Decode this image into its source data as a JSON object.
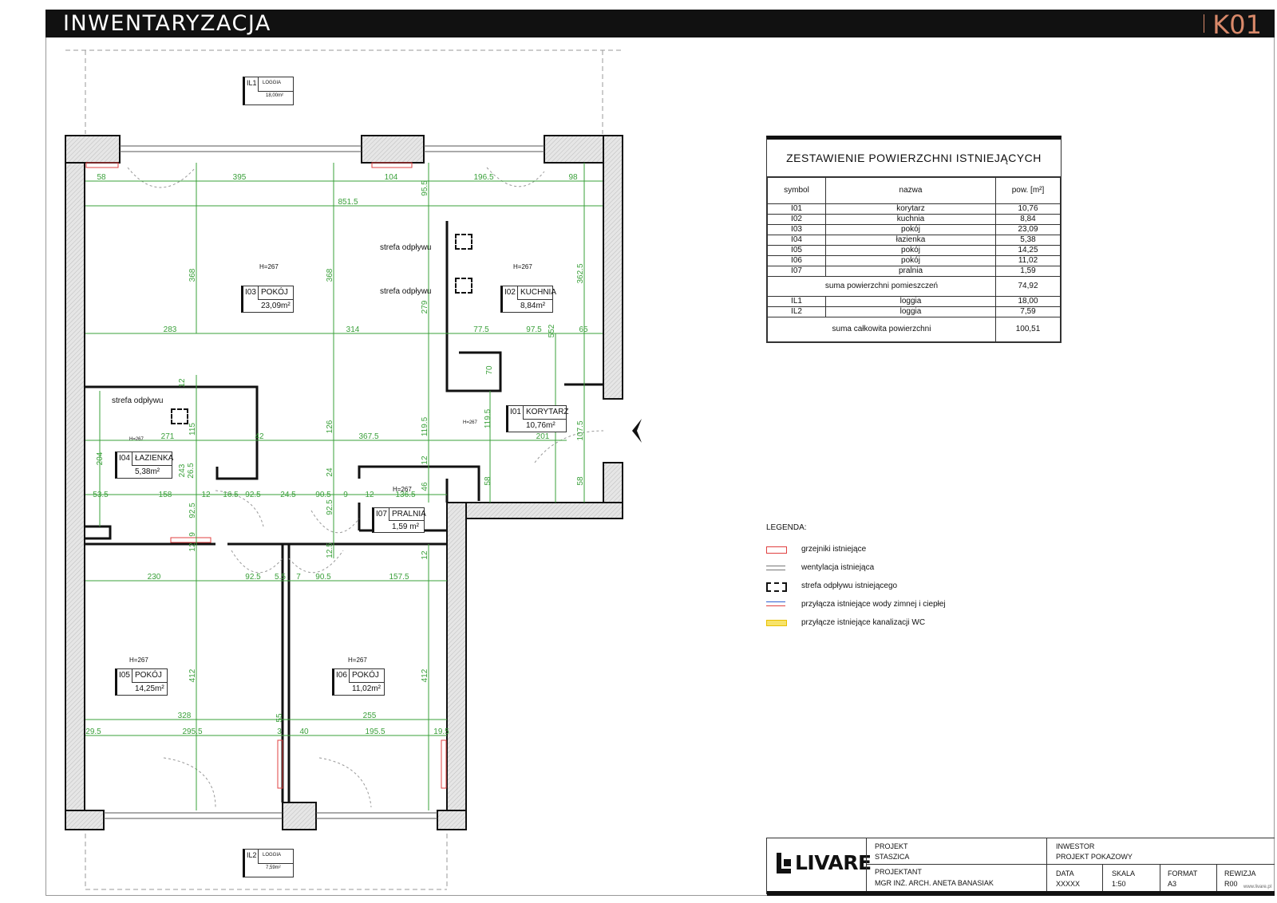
{
  "header": {
    "title": "INWENTARYZACJA",
    "code": "K01"
  },
  "rooms": [
    {
      "id": "IL1",
      "name": "LOGGIA",
      "area": "18,00m²"
    },
    {
      "id": "IL2",
      "name": "LOGGIA",
      "area": "7,59m²"
    },
    {
      "id": "I03",
      "name": "POKÓJ",
      "area": "23,09m²",
      "height": "H=267"
    },
    {
      "id": "I02",
      "name": "KUCHNIA",
      "area": "8,84m²",
      "height": "H=267"
    },
    {
      "id": "I01",
      "name": "KORYTARZ",
      "area": "10,76m²",
      "height": "H=267"
    },
    {
      "id": "I04",
      "name": "ŁAZIENKA",
      "area": "5,38m²",
      "height": "H=267"
    },
    {
      "id": "I07",
      "name": "PRALNIA",
      "area": "1,59 m²",
      "height": "H=267"
    },
    {
      "id": "I05",
      "name": "POKÓJ",
      "area": "14,25m²",
      "height": "H=267"
    },
    {
      "id": "I06",
      "name": "POKÓJ",
      "area": "11,02m²",
      "height": "H=267"
    }
  ],
  "drain_label": "strefa odpływu",
  "dimensions": {
    "top_row": [
      "58",
      "395",
      "104",
      "196.5",
      "98"
    ],
    "overall": "851.5",
    "mid_row": [
      "283",
      "314",
      "77.5",
      "97.5",
      "65"
    ],
    "corridor_row": [
      "271",
      "42",
      "367.5",
      "201"
    ],
    "lower_row": [
      "53.5",
      "158",
      "12",
      "16.5",
      "92.5",
      "24.5",
      "90.5",
      "9",
      "12",
      "136.5"
    ],
    "rooms_row": [
      "230",
      "92.5",
      "5.5",
      "7",
      "90.5",
      "157.5"
    ],
    "bottom_row1": [
      "328",
      "255"
    ],
    "bottom_row2": [
      "29.5",
      "295.5",
      "3",
      "40",
      "195.5",
      "19.5"
    ],
    "vertical": [
      "368",
      "368",
      "95.5",
      "279",
      "362.5",
      "552",
      "70",
      "12",
      "115",
      "126",
      "119.5",
      "119.5",
      "107.5",
      "204",
      "243",
      "26.5",
      "24",
      "12",
      "46",
      "58",
      "58",
      "92.5",
      "92.5",
      "9",
      "12",
      "12.5",
      "12",
      "412",
      "412",
      "55"
    ]
  },
  "area_table": {
    "title": "ZESTAWIENIE POWIERZCHNI ISTNIEJĄCYCH",
    "columns": [
      "symbol",
      "nazwa",
      "pow. [m²]"
    ],
    "rows": [
      [
        "I01",
        "korytarz",
        "10,76"
      ],
      [
        "I02",
        "kuchnia",
        "8,84"
      ],
      [
        "I03",
        "pokój",
        "23,09"
      ],
      [
        "I04",
        "łazienka",
        "5,38"
      ],
      [
        "I05",
        "pokój",
        "14,25"
      ],
      [
        "I06",
        "pokój",
        "11,02"
      ],
      [
        "I07",
        "pralnia",
        "1,59"
      ]
    ],
    "sum_rooms_label": "suma powierzchni pomieszczeń",
    "sum_rooms_value": "74,92",
    "loggia_rows": [
      [
        "IL1",
        "loggia",
        "18,00"
      ],
      [
        "IL2",
        "loggia",
        "7,59"
      ]
    ],
    "total_label": "suma całkowita powierzchni",
    "total_value": "100,51"
  },
  "legend": {
    "title": "LEGENDA:",
    "items": [
      {
        "icon": "radiator-symbol",
        "label": "grzejniki istniejące",
        "color": "#e04040"
      },
      {
        "icon": "ventilation-symbol",
        "label": "wentylacja istniejąca",
        "color": "#555555"
      },
      {
        "icon": "drain-zone-symbol",
        "label": "strefa odpływu istniejącego",
        "color": "#111111"
      },
      {
        "icon": "water-connection-symbol",
        "label": "przyłącza istniejące wody zimnej i ciepłej",
        "color": "#3060d0"
      },
      {
        "icon": "sewage-connection-symbol",
        "label": "przyłącze istniejące kanalizacji WC",
        "color": "#e8c000"
      }
    ]
  },
  "title_block": {
    "logo": "LIVARE",
    "project_label": "PROJEKT",
    "project_value": "STASZICA",
    "investor_label": "INWESTOR",
    "investor_value": "PROJEKT POKAZOWY",
    "designer_label": "PROJEKTANT",
    "designer_value": "MGR INŻ. ARCH. ANETA BANASIAK",
    "date_label": "DATA",
    "date_value": "XXXXX",
    "scale_label": "SKALA",
    "scale_value": "1:50",
    "format_label": "FORMAT",
    "format_value": "A3",
    "revision_label": "REWIZJA",
    "revision_value": "R00",
    "website": "www.livare.pl"
  },
  "colors": {
    "dimension": "#3aa03a",
    "wall": "#111111",
    "hatch": "#cfcfcf",
    "accent": "#d9896a"
  }
}
